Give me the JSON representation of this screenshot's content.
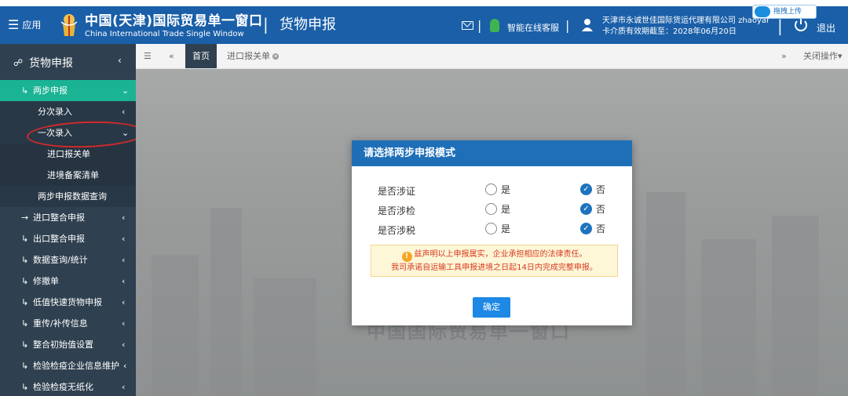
{
  "header": {
    "apps_label": "应用",
    "brand_cn": "中国(天津)国际贸易单一窗口",
    "brand_en": "China International Trade Single Window",
    "separator": "|",
    "module_title": "货物申报",
    "service_label": "智能在线客服",
    "company_line1": "天津市永诚世佳国际货运代理有限公司 zhaoyang",
    "company_line2": "卡介质有效期截至：2028年06月20日",
    "logout_label": "退出",
    "upload_tag": "拖拽上传"
  },
  "sidebar": {
    "title": "货物申报",
    "items": [
      {
        "label": "两步申报",
        "icon": "↳"
      },
      {
        "label": "分次录入"
      },
      {
        "label": "一次录入"
      },
      {
        "label": "进口报关单"
      },
      {
        "label": "进境备案清单"
      },
      {
        "label": "两步申报数据查询"
      },
      {
        "label": "进口整合申报",
        "icon": "→"
      },
      {
        "label": "出口整合申报",
        "icon": "↳"
      },
      {
        "label": "数据查询/统计",
        "icon": "↳"
      },
      {
        "label": "修撤单",
        "icon": "↳"
      },
      {
        "label": "低值快速货物申报",
        "icon": "↳"
      },
      {
        "label": "重传/补传信息",
        "icon": "↳"
      },
      {
        "label": "整合初始值设置",
        "icon": "↳"
      },
      {
        "label": "检验检疫企业信息维护",
        "icon": "↳"
      },
      {
        "label": "检验检疫无纸化",
        "icon": "↳"
      }
    ]
  },
  "tabs": {
    "home": "首页",
    "import_declaration": "进口报关单",
    "close_ops": "关闭操作"
  },
  "background_watermark": "中国国际贸易单一窗口",
  "modal": {
    "title": "请选择两步申报模式",
    "questions": [
      {
        "label": "是否涉证",
        "yes": "是",
        "no": "否",
        "selected": "否"
      },
      {
        "label": "是否涉检",
        "yes": "是",
        "no": "否",
        "selected": "否"
      },
      {
        "label": "是否涉税",
        "yes": "是",
        "no": "否",
        "selected": "否"
      }
    ],
    "warning_line1": "兹声明以上申报属实，企业承担相应的法律责任。",
    "warning_line2": "我司承诺自运输工具申报进境之日起14日内完成完整申报。",
    "confirm_label": "确定"
  },
  "colors": {
    "header_blue": "#1a5fa8",
    "sidebar_dark": "#2f4050",
    "sidebar_active": "#1ab394",
    "modal_header": "#1e6fb8",
    "warning_text": "#d83a1f"
  }
}
